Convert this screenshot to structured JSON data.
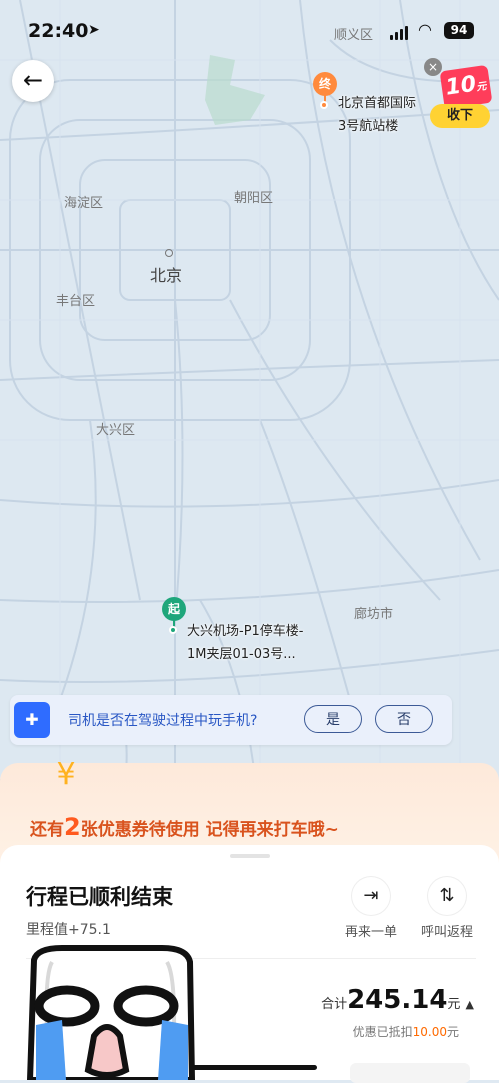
{
  "status_bar": {
    "time": "22:40",
    "battery": "94"
  },
  "map": {
    "district_labels": [
      "顺义区",
      "海淀区",
      "朝阳区",
      "丰台区",
      "大兴区",
      "廊坊市"
    ],
    "city_label": "北京",
    "end_marker": "终",
    "start_marker": "起",
    "end_place": [
      "北京首都国际",
      "3号航站楼"
    ],
    "start_place": [
      "大兴机场-P1停车楼-",
      "1M夹层01-03号..."
    ]
  },
  "coupon_ad": {
    "amount": "10",
    "unit": "元",
    "take_label": "收下",
    "close": "×"
  },
  "survey": {
    "question": "司机是否在驾驶过程中玩手机?",
    "yes": "是",
    "no": "否"
  },
  "promo": {
    "prefix": "还有",
    "count": "2",
    "suffix": "张优惠券待使用 记得再来打车哦~"
  },
  "trip": {
    "title": "行程已顺利结束",
    "mileage": "里程值+75.1",
    "actions": [
      {
        "label": "再来一单",
        "icon": "arrow-right-circle-icon"
      },
      {
        "label": "呼叫返程",
        "icon": "swap-icon"
      }
    ],
    "total_label": "合计",
    "total_amount": "245.14",
    "total_unit": "元",
    "discount_prefix": "优惠已抵扣",
    "discount_amount": "10.00",
    "discount_unit": "元"
  },
  "colors": {
    "accent_blue": "#2f6cff",
    "promo_orange": "#ff5a1f",
    "start_green": "#1ea67b",
    "end_orange": "#ff8a3d"
  }
}
